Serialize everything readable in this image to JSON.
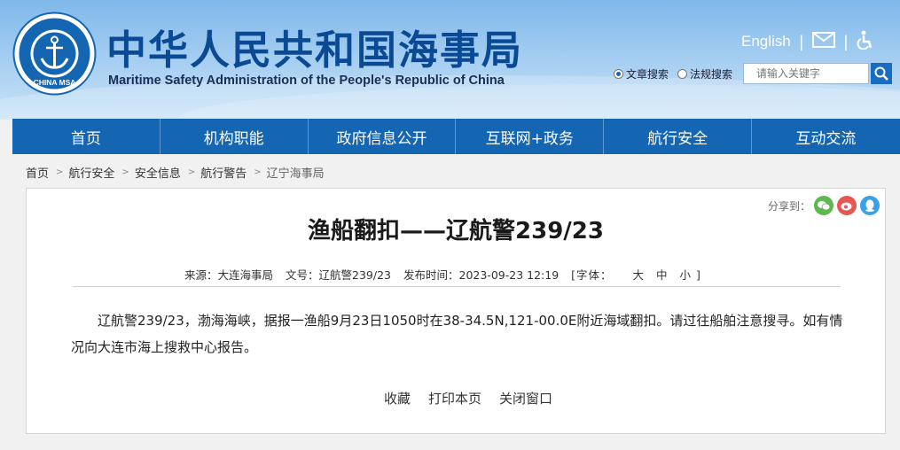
{
  "header": {
    "title": "中华人民共和国海事局",
    "subtitle": "Maritime Safety Administration of the People's Republic of China",
    "logo_text": "CHINA MSA",
    "english_link": "English",
    "search": {
      "option1": "文章搜索",
      "option2": "法规搜索",
      "selected": "文章搜索",
      "placeholder": "请输入关键字"
    }
  },
  "nav": [
    "首页",
    "机构职能",
    "政府信息公开",
    "互联网+政务",
    "航行安全",
    "互动交流"
  ],
  "breadcrumb": [
    "首页",
    "航行安全",
    "安全信息",
    "航行警告",
    "辽宁海事局"
  ],
  "article": {
    "share_label": "分享到：",
    "title": "渔船翻扣——辽航警239/23",
    "source": "来源：大连海事局",
    "doc_no": "文号：辽航警239/23",
    "published": "发布时间：2023-09-23 12:19",
    "font_label": "[字体：",
    "font_large": "大",
    "font_medium": "中",
    "font_small": "小 ]",
    "body": "辽航警239/23，渤海海峡，据报一渔船9月23日1050时在38-34.5N,121-00.0E附近海域翻扣。请过往船舶注意搜寻。如有情况向大连市海上搜救中心报告。",
    "actions": [
      "收藏",
      "打印本页",
      "关闭窗口"
    ]
  },
  "colors": {
    "nav_bg": "#1466b3",
    "title_blue": "#0a4a94",
    "wechat": "#5cb84f",
    "weibo": "#e5584f",
    "qq": "#3aa1e8"
  },
  "icons": [
    "mail-icon",
    "accessibility-icon",
    "search-icon",
    "wechat-icon",
    "weibo-icon",
    "qq-icon"
  ]
}
